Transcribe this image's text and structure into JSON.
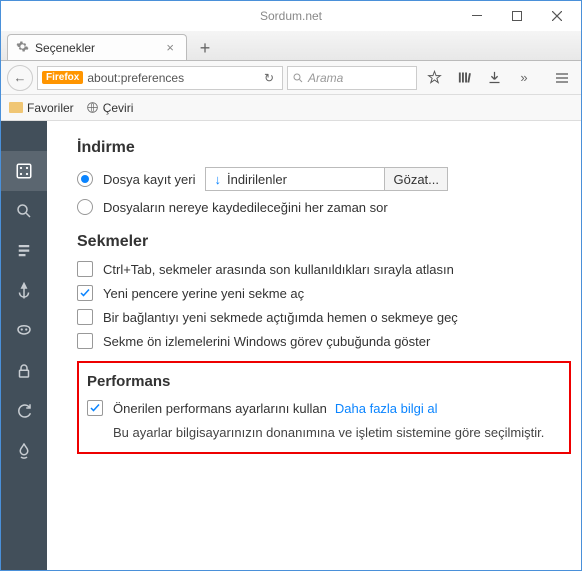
{
  "window": {
    "title": "Sordum.net"
  },
  "tab": {
    "title": "Seçenekler"
  },
  "url": {
    "badge": "Firefox",
    "value": "about:preferences"
  },
  "search": {
    "placeholder": "Arama"
  },
  "bookmarks": {
    "fav": "Favoriler",
    "translate": "Çeviri"
  },
  "downloads": {
    "title": "İndirme",
    "saveTo": "Dosya kayıt yeri",
    "folder": "İndirilenler",
    "browse": "Gözat...",
    "ask": "Dosyaların nereye kaydedileceğini her zaman sor"
  },
  "tabs": {
    "title": "Sekmeler",
    "ctrlTab": "Ctrl+Tab, sekmeler arasında son kullanıldıkları sırayla atlasın",
    "newTab": "Yeni pencere yerine yeni sekme aç",
    "openLink": "Bir bağlantıyı yeni sekmede açtığımda hemen o sekmeye geç",
    "taskbar": "Sekme ön izlemelerini Windows görev çubuğunda göster"
  },
  "perf": {
    "title": "Performans",
    "recommended": "Önerilen performans ayarlarını kullan",
    "learnMore": "Daha fazla bilgi al",
    "desc": "Bu ayarlar bilgisayarınızın donanımına ve işletim sistemine göre seçilmiştir."
  }
}
